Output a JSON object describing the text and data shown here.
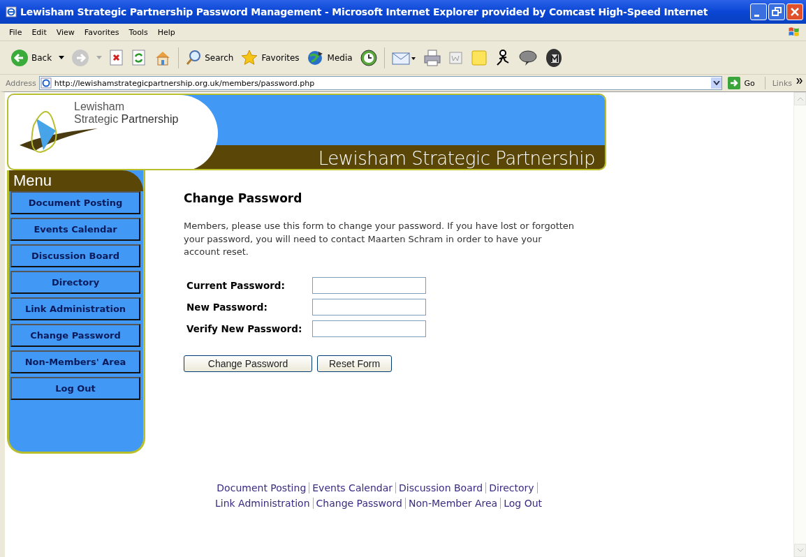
{
  "window": {
    "title": "Lewisham Strategic Partnership Password Management - Microsoft Internet Explorer provided by Comcast High-Speed Internet"
  },
  "menu_bar": [
    "File",
    "Edit",
    "View",
    "Favorites",
    "Tools",
    "Help"
  ],
  "toolbar": [
    {
      "kind": "back",
      "label": "Back"
    },
    {
      "kind": "forward"
    },
    {
      "kind": "stop"
    },
    {
      "kind": "refresh"
    },
    {
      "kind": "home"
    },
    {
      "kind": "search",
      "label": "Search"
    },
    {
      "kind": "favorites",
      "label": "Favorites"
    },
    {
      "kind": "media",
      "label": "Media"
    },
    {
      "kind": "history"
    },
    {
      "kind": "mail"
    },
    {
      "kind": "print"
    },
    {
      "kind": "edit"
    },
    {
      "kind": "note"
    },
    {
      "kind": "messenger"
    },
    {
      "kind": "discuss"
    },
    {
      "kind": "app"
    }
  ],
  "address_bar": {
    "label": "Address",
    "url": "http://lewishamstrategicpartnership.org.uk/members/password.php",
    "go": "Go",
    "links": "Links"
  },
  "banner": {
    "logo_line_1": "Lewisham",
    "logo_line_2": "Strategic **Partnership**",
    "title": "Lewisham Strategic Partnership"
  },
  "sidebar": {
    "heading": "Menu",
    "items": [
      "Document Posting",
      "Events Calendar",
      "Discussion Board",
      "Directory",
      "Link Administration",
      "Change Password",
      "Non-Members' Area",
      "Log Out"
    ]
  },
  "main": {
    "heading": "Change Password",
    "intro": "Members, please use this form to change your password. If you have lost or forgotten your password, you will need to contact Maarten Schram in order to have your account reset.",
    "fields": [
      {
        "label": "Current Password:"
      },
      {
        "label": "New Password:"
      },
      {
        "label": "Verify New Password:"
      }
    ],
    "buttons": [
      "Change Password",
      "Reset Form"
    ]
  },
  "footer_links": [
    "Document Posting",
    "Events Calendar",
    "Discussion Board",
    "Directory",
    "Link Administration",
    "Change Password",
    "Non-Member Area",
    "Log Out"
  ]
}
